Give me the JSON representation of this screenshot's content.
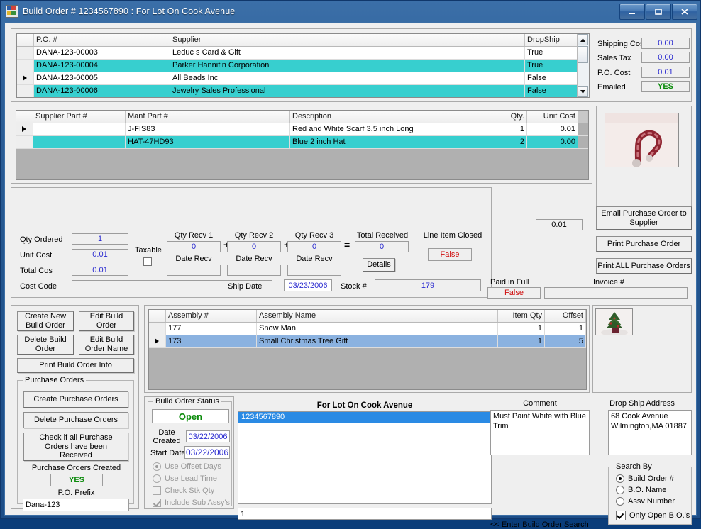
{
  "window": {
    "title": "Build Order # 1234567890 : For Lot On Cook Avenue",
    "minimize": "–",
    "maximize": "□",
    "close": "X"
  },
  "po_grid": {
    "columns": [
      "",
      "P.O. #",
      "Supplier",
      "DropShip"
    ],
    "rows": [
      {
        "selected": false,
        "highlight": "none",
        "po": "DANA-123-00003",
        "supplier": "Leduc s Card & Gift",
        "dropship": "True"
      },
      {
        "selected": false,
        "highlight": "teal",
        "po": "DANA-123-00004",
        "supplier": "Parker Hannifin Corporation",
        "dropship": "True"
      },
      {
        "selected": true,
        "highlight": "none",
        "po": "DANA-123-00005",
        "supplier": "All Beads Inc",
        "dropship": "False"
      },
      {
        "selected": false,
        "highlight": "teal",
        "po": "DANA-123-00006",
        "supplier": "Jewelry Sales Professional",
        "dropship": "False"
      }
    ]
  },
  "po_summary": {
    "shipping_cost_label": "Shipping Cos",
    "shipping_cost_value": "0.00",
    "sales_tax_label": "Sales Tax",
    "sales_tax_value": "0.00",
    "po_cost_label": "P.O. Cost",
    "po_cost_value": "0.01",
    "emailed_label": "Emailed",
    "emailed_value": "YES"
  },
  "line_grid": {
    "columns": [
      "",
      "Supplier Part #",
      "Manf Part #",
      "Description",
      "Qty.",
      "Unit Cost"
    ],
    "rows": [
      {
        "selected": true,
        "highlight": "none",
        "supplier_part": "",
        "manf_part": "J-FIS83",
        "description": "Red and White Scarf 3.5 inch Long",
        "qty": "1",
        "unit_cost": "0.01"
      },
      {
        "selected": false,
        "highlight": "teal",
        "supplier_part": "",
        "manf_part": "HAT-47HD93",
        "description": "Blue 2 inch Hat",
        "qty": "2",
        "unit_cost": "0.00"
      }
    ]
  },
  "item_detail": {
    "qty_ordered_label": "Qty Ordered",
    "qty_ordered_value": "1",
    "unit_cost_label": "Unit Cost",
    "unit_cost_value": "0.01",
    "total_cost_label": "Total Cos",
    "total_cost_value": "0.01",
    "cost_code_label": "Cost Code",
    "cost_code_value": "",
    "taxable_label": "Taxable",
    "taxable_checked": false,
    "qty_recv_1_label": "Qty Recv 1",
    "qty_recv_1_value": "0",
    "date_recv_1_label": "Date Recv",
    "date_recv_1_value": "",
    "plus_1": "+",
    "qty_recv_2_label": "Qty Recv 2",
    "qty_recv_2_value": "0",
    "date_recv_2_label": "Date Recv",
    "date_recv_2_value": "",
    "plus_2": "+",
    "qty_recv_3_label": "Qty Recv 3",
    "qty_recv_3_value": "0",
    "date_recv_3_label": "Date Recv",
    "date_recv_3_value": "",
    "equals": "=",
    "total_received_label": "Total Received",
    "total_received_value": "0",
    "details_button": "Details",
    "line_item_closed_label": "Line Item Closed",
    "line_item_closed_value": "False",
    "ship_date_label": "Ship Date",
    "ship_date_value": "03/23/2006",
    "stock_label": "Stock #",
    "stock_value": "179",
    "paid_in_full_label": "Paid in Full",
    "paid_in_full_value": "False",
    "invoice_label": "Invoice #",
    "invoice_value": "",
    "total_value": "0.01"
  },
  "po_actions": {
    "email_po": "Email Purchase Order to\nSupplier",
    "print_po": "Print Purchase Order",
    "print_all_po": "Print ALL Purchase Orders",
    "part_image": "candy-cane-scarf-photo"
  },
  "build_actions": {
    "create_new_build_order": "Create New\nBuild Order",
    "edit_build_order": "Edit Build\nOrder",
    "delete_build_order": "Delete Build\nOrder",
    "edit_build_order_name": "Edit Build\nOrder Name",
    "print_build_order_info": "Print Build Order Info"
  },
  "purchase_orders_group": {
    "legend": "Purchase Orders",
    "create": "Create Purchase Orders",
    "delete": "Delete Purchase Orders",
    "check_received": "Check if all Purchase\nOrders have been\nReceived",
    "created_label": "Purchase Orders Created",
    "created_value": "YES",
    "prefix_label": "P.O. Prefix",
    "prefix_value": "Dana-123"
  },
  "assembly_grid": {
    "columns": [
      "",
      "Assembly #",
      "Assembly Name",
      "Item Qty",
      "Offset"
    ],
    "rows": [
      {
        "selected": false,
        "highlight": "none",
        "assembly_no": "177",
        "assembly_name": "Snow Man",
        "item_qty": "1",
        "offset": "1"
      },
      {
        "selected": true,
        "highlight": "blue",
        "assembly_no": "173",
        "assembly_name": "Small Christmas Tree Gift",
        "item_qty": "1",
        "offset": "5"
      }
    ],
    "thumbnail": "potted-christmas-tree-photo"
  },
  "build_status": {
    "legend": "Build Odrer Status",
    "status_value": "Open",
    "date_created_label": "Date\nCreated",
    "date_created_value": "03/22/2006",
    "start_date_label": "Start Date",
    "start_date_value": "03/22/2006",
    "use_offset_days": "Use Offset Days",
    "use_lead_time": "Use Lead Time",
    "check_stk_qty": "Check Stk Qty",
    "include_sub_assys": "Include Sub Assy's",
    "offset_selected": true,
    "lead_selected": false,
    "stk_checked": false,
    "sub_checked": true
  },
  "build_list": {
    "header": "For Lot On Cook Avenue",
    "items": [
      "1234567890"
    ],
    "selected_index": 0,
    "search_value": "1",
    "search_hint": "<<  Enter Build Order Search"
  },
  "comment": {
    "label": "Comment",
    "value": "Must Paint White with Blue Trim"
  },
  "drop_ship": {
    "label": "Drop Ship Address",
    "line1": "68 Cook Avenue",
    "line2": "Wilmington,MA 01887"
  },
  "search_by": {
    "legend": "Search By",
    "options": [
      "Build Order #",
      "B.O. Name",
      "Assv Number"
    ],
    "selected_index": 0,
    "only_open_label": "Only Open B.O.'s",
    "only_open_checked": true
  },
  "colors": {
    "teal_row": "#37cfcf",
    "blue_row": "#8bb2e0",
    "list_select": "#2a8ae4",
    "value_text": "#2b2bd0",
    "status_ok": "#0a8a0a",
    "status_bad": "#d01010"
  }
}
